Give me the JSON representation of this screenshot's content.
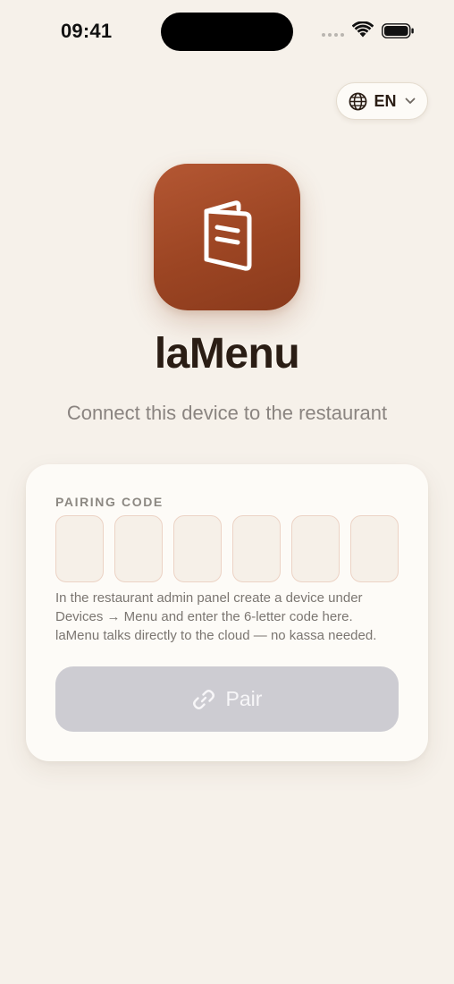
{
  "status_bar": {
    "time": "09:41"
  },
  "language": {
    "code": "EN",
    "icon": "globe-icon"
  },
  "app": {
    "name": "laMenu",
    "subtitle": "Connect this device to the restaurant",
    "icon": "menu-book-icon",
    "brand_color": "#a14a25"
  },
  "pairing": {
    "label": "PAIRING CODE",
    "code_length": 6,
    "code_values": [
      "",
      "",
      "",
      "",
      "",
      ""
    ],
    "help_line_1": "In the restaurant admin panel create a device under",
    "help_line_2": "Devices → Menu and enter the 6-letter code here.",
    "help_line_3": "laMenu talks directly to the cloud — no kassa needed.",
    "button_label": "Pair",
    "button_icon": "link-icon",
    "button_state": "disabled"
  }
}
